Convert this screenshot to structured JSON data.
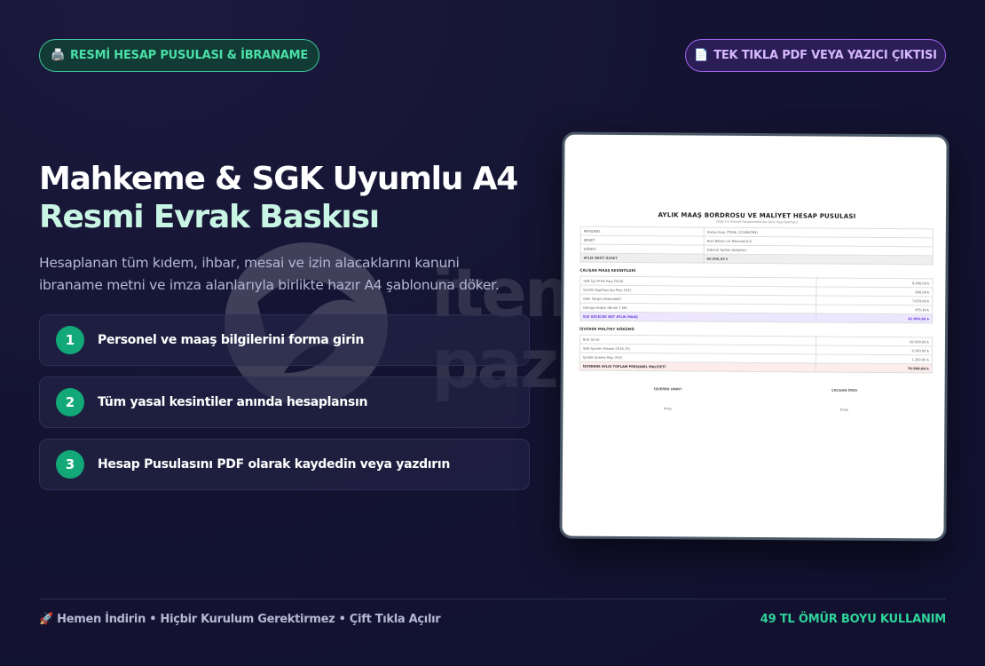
{
  "header": {
    "left_badge": "RESMİ HESAP PUSULASI & İBRANAME",
    "left_badge_icon": "printer-icon",
    "left_badge_icon_char": "🖨️",
    "right_badge": "TEK TIKLA PDF VEYA YAZICI ÇIKTISI",
    "right_badge_icon": "document-icon",
    "right_badge_icon_char": "📄"
  },
  "hero": {
    "title_line1": "Mahkeme & SGK Uyumlu A4",
    "title_line2": "Resmi Evrak Baskısı",
    "subtitle": "Hesaplanan tüm kıdem, ihbar, mesai ve izin alacaklarını kanuni ibraname metni ve imza alanlarıyla birlikte hazır A4 şablonuna döker."
  },
  "steps": [
    {
      "number": "1",
      "label": "Personel ve maaş bilgilerini forma girin"
    },
    {
      "number": "2",
      "label": "Tüm yasal kesintiler anında hesaplansın"
    },
    {
      "number": "3",
      "label": "Hesap Pusulasını PDF olarak kaydedin veya yazdırın"
    }
  ],
  "watermark": {
    "line1": "item",
    "line2": "paz"
  },
  "document": {
    "title": "AYLIK MAAŞ BORDROSU VE MALİYET HESAP PUSULASI",
    "subtitle": "2026 Yılı Güncel Parametrelerine Göre Hazırlanmıştır",
    "info_rows": [
      {
        "label": "PERSONEL",
        "value": "Hasan Kara (TCKN: 123456789)"
      },
      {
        "label": "ŞİRKET",
        "value": "Ares Bilişim ve Teknoloji A.Ş."
      },
      {
        "label": "GÖREVİ",
        "value": "Kıdemli Yazılım Geliştirici"
      },
      {
        "label": "AYLIK BRÜT ÜCRET",
        "value": "60.000,00 ₺"
      }
    ],
    "deductions_title": "ÇALIŞAN MAAŞ KESİNTİLERİ",
    "deductions": [
      {
        "label": "SGK İşçi Primi Payı (%14)",
        "value": "8.400,00 ₺"
      },
      {
        "label": "İşsizlik Sigortası İşçi Payı (%1)",
        "value": "600,00 ₺"
      },
      {
        "label": "Gelir Vergisi (Kümülatif)",
        "value": "7.650,00 ₺"
      },
      {
        "label": "Damga Vergisi (Binde 7,59)",
        "value": "455,40 ₺"
      }
    ],
    "net_label": "ELE GEÇECEK NET AYLIK MAAŞ",
    "net_value": "42.894,60 ₺",
    "cost_title": "İŞVEREN MALİYET DÖKÜMÜ",
    "costs": [
      {
        "label": "Brüt Ücret",
        "value": "60.000,00 ₺"
      },
      {
        "label": "SGK İşveren Hissesi (%15,75)",
        "value": "9.300,00 ₺"
      },
      {
        "label": "İşsizlik İşveren Payı (%2)",
        "value": "1.200,00 ₺"
      }
    ],
    "total_label": "İŞVERENE AYLIK TOPLAM PERSONEL MALİYETİ",
    "total_value": "70.500,00 ₺",
    "sign_left": "İŞVEREN ONAYI",
    "sign_right": "ÇALIŞAN İMZA",
    "imza": "İmza"
  },
  "footer": {
    "left": "🚀 Hemen İndirin • Hiçbir Kurulum Gerektirmez • Çift Tıkla Açılır",
    "right": "49 TL ÖMÜR BOYU KULLANIM"
  },
  "colors": {
    "accent_green": "#2fd49a",
    "accent_purple": "#a062ea",
    "background": "#141432"
  }
}
